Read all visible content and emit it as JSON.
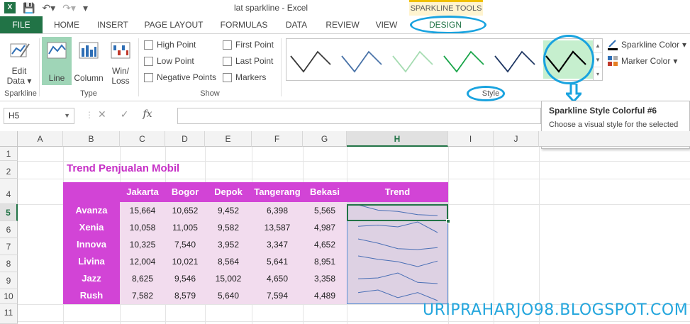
{
  "window": {
    "title": "lat sparkline - Excel",
    "contextual_tab": "SPARKLINE TOOLS"
  },
  "tabs": [
    "FILE",
    "HOME",
    "INSERT",
    "PAGE LAYOUT",
    "FORMULAS",
    "DATA",
    "REVIEW",
    "VIEW",
    "DESIGN"
  ],
  "ribbon": {
    "sparkline_group": {
      "edit_data_line1": "Edit",
      "edit_data_line2": "Data",
      "label": "Sparkline"
    },
    "type_group": {
      "line": "Line",
      "column": "Column",
      "winloss_line1": "Win/",
      "winloss_line2": "Loss",
      "label": "Type"
    },
    "show_group": {
      "items": [
        "High Point",
        "Low Point",
        "Negative Points",
        "First Point",
        "Last Point",
        "Markers"
      ],
      "label": "Show"
    },
    "style_group": {
      "label": "Style",
      "swatch_colors": [
        "#3a3a3a",
        "#4a73a8",
        "#a6dcb2",
        "#1aa54a",
        "#203864",
        "#000000"
      ]
    },
    "sparkline_color": "Sparkline Color",
    "marker_color": "Marker Color"
  },
  "tooltip": {
    "title": "Sparkline Style Colorful #6",
    "body": "Choose a visual style for the selected sparkline group."
  },
  "formula_bar": {
    "name_box": "H5",
    "fx": "fx"
  },
  "columns": [
    "A",
    "B",
    "C",
    "D",
    "E",
    "F",
    "G",
    "H",
    "I",
    "J"
  ],
  "rows": [
    "1",
    "2",
    "4",
    "5",
    "6",
    "7",
    "8",
    "9",
    "10",
    "11"
  ],
  "sheet": {
    "title": "Trend Penjualan Mobil",
    "headers": [
      "Jakarta",
      "Bogor",
      "Depok",
      "Tangerang",
      "Bekasi",
      "Trend"
    ],
    "data": [
      {
        "name": "Avanza",
        "values": [
          "15,664",
          "10,652",
          "9,452",
          "6,398",
          "5,565"
        ]
      },
      {
        "name": "Xenia",
        "values": [
          "10,058",
          "11,005",
          "9,582",
          "13,587",
          "4,987"
        ]
      },
      {
        "name": "Innova",
        "values": [
          "10,325",
          "7,540",
          "3,952",
          "3,347",
          "4,652"
        ]
      },
      {
        "name": "Livina",
        "values": [
          "12,004",
          "10,021",
          "8,564",
          "5,641",
          "8,951"
        ]
      },
      {
        "name": "Jazz",
        "values": [
          "8,625",
          "9,546",
          "15,002",
          "4,650",
          "3,358"
        ]
      },
      {
        "name": "Rush",
        "values": [
          "7,582",
          "8,579",
          "5,640",
          "7,594",
          "4,489"
        ]
      }
    ]
  },
  "watermark": "URIPRAHARJO98.BLOGSPOT.COM"
}
